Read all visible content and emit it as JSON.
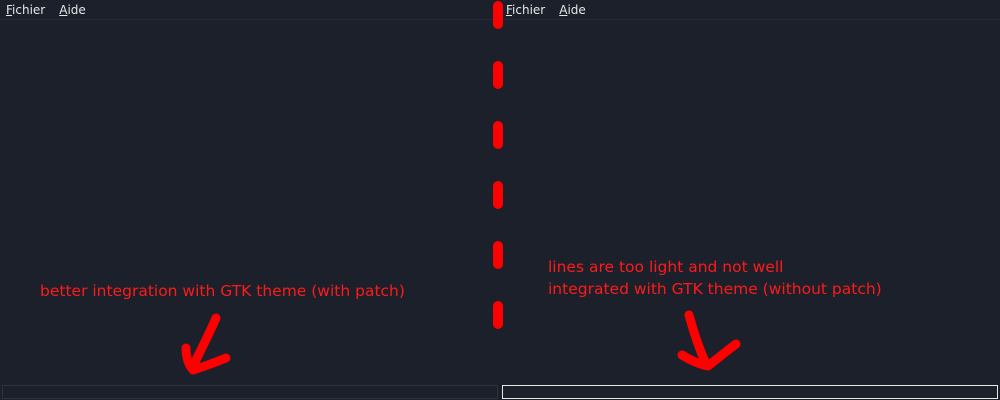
{
  "left_window": {
    "menu": [
      {
        "mnemonic": "F",
        "rest": "ichier"
      },
      {
        "mnemonic": "A",
        "rest": "ide"
      }
    ],
    "annotation": "better integration with GTK theme (with patch)"
  },
  "right_window": {
    "menu": [
      {
        "mnemonic": "F",
        "rest": "ichier"
      },
      {
        "mnemonic": "A",
        "rest": "ide"
      }
    ],
    "annotation_line1": "lines are too light and not well",
    "annotation_line2": "integrated with GTK theme (without patch)"
  },
  "colors": {
    "background": "#1b202a",
    "annotation": "#ff1a1a",
    "unpatched_border": "#e8e8e8",
    "patched_border": "#2c3340"
  }
}
